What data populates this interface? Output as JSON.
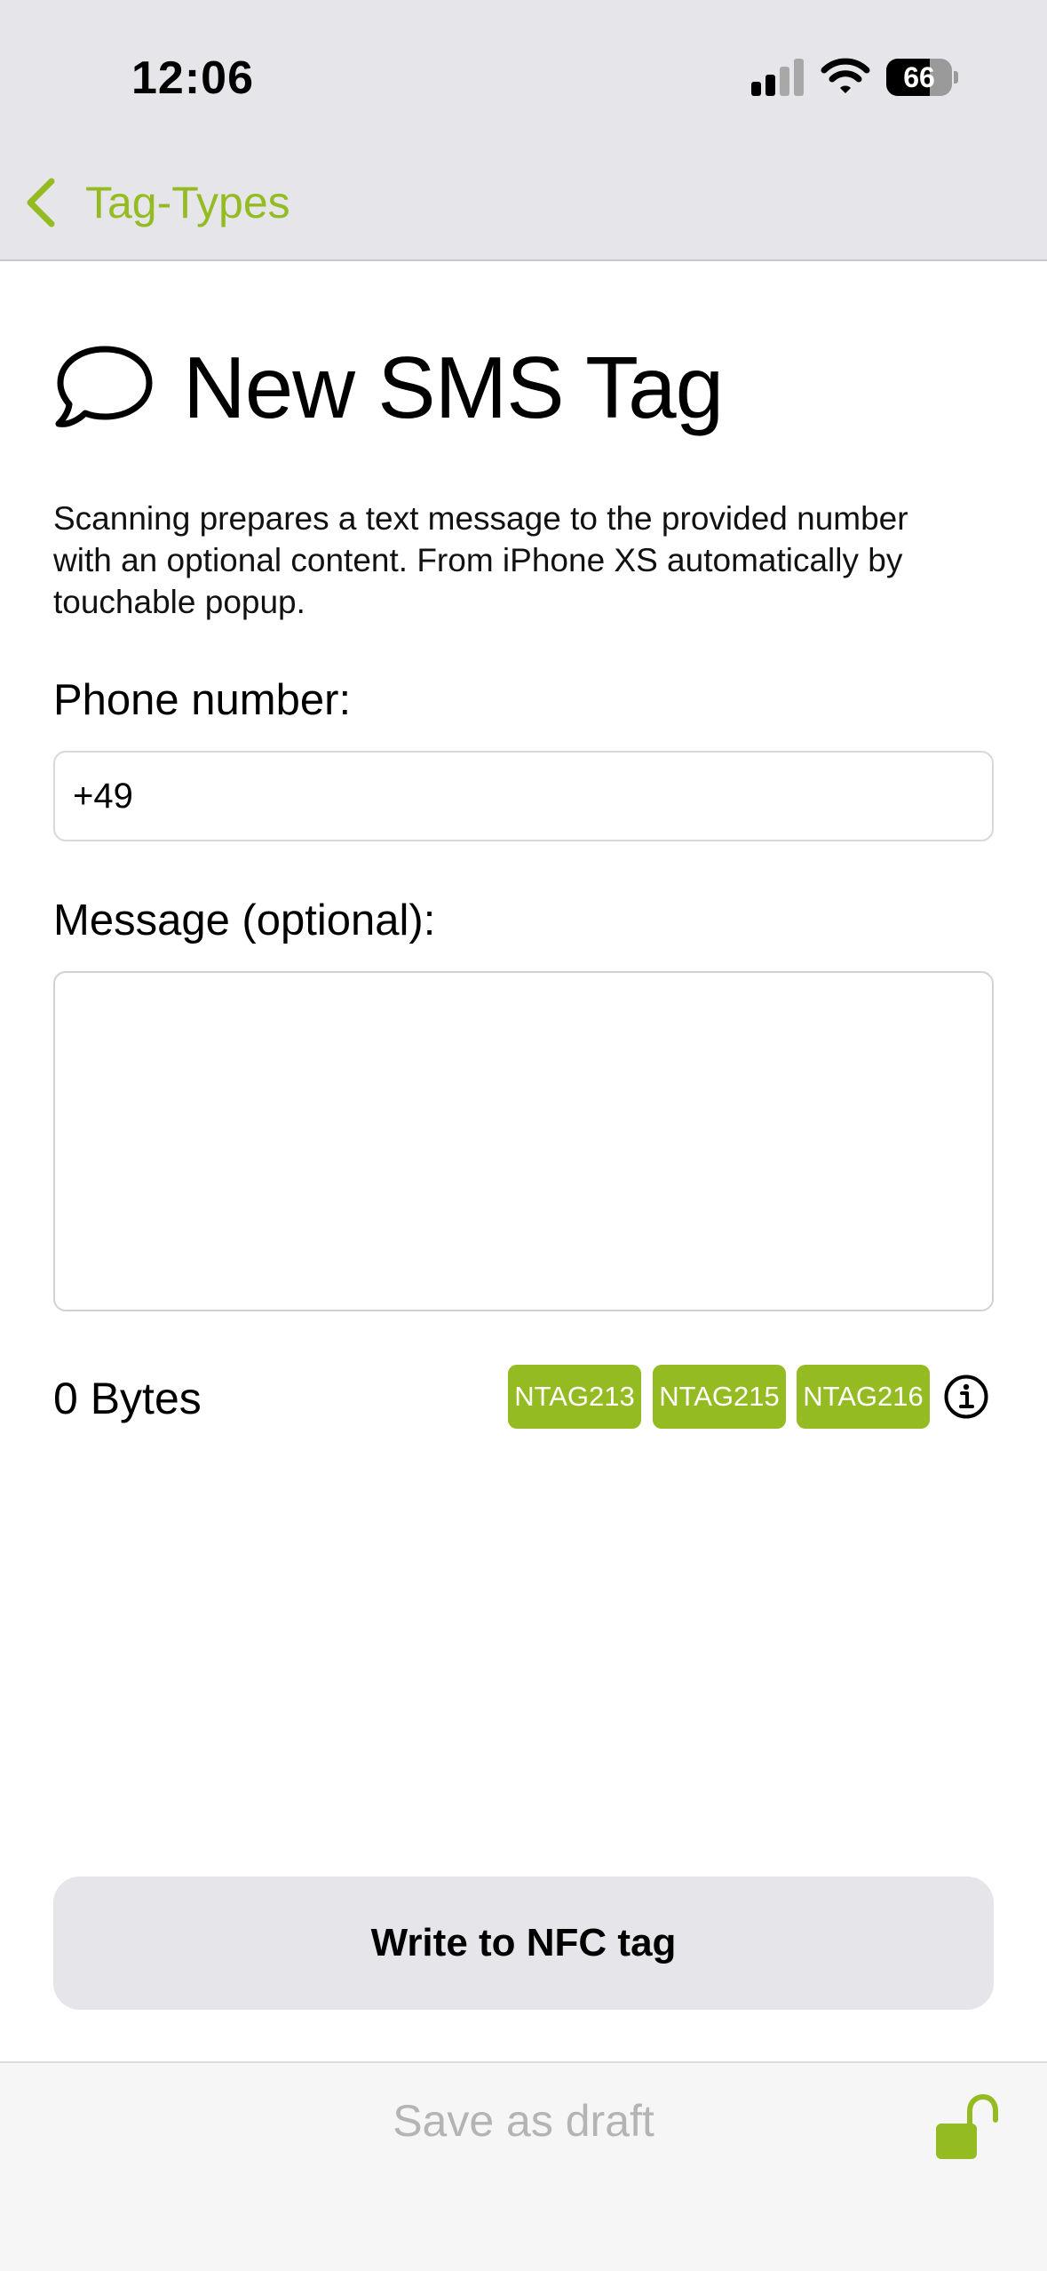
{
  "status_bar": {
    "time": "12:06",
    "battery_percent": "66",
    "battery_level": 0.66,
    "signal_bars_active": 2,
    "signal_bars_total": 4
  },
  "nav": {
    "back_label": "Tag-Types"
  },
  "main": {
    "title": "New SMS Tag",
    "description": "Scanning prepares a text message to the provided number with an optional content. From iPhone XS automatically by touchable popup.",
    "phone_label": "Phone number:",
    "phone_value": "+49",
    "message_label": "Message (optional):",
    "message_value": "",
    "bytes_label": "0 Bytes",
    "tag_types": [
      "NTAG213",
      "NTAG215",
      "NTAG216"
    ],
    "write_button_label": "Write to NFC tag"
  },
  "toolbar": {
    "save_draft_label": "Save as draft"
  },
  "colors": {
    "accent": "#95bb23",
    "header_bg": "#e6e6ea",
    "disabled_text": "#b4b4b4"
  },
  "icons": {
    "back": "chevron-left-icon",
    "title": "speech-bubble-icon",
    "info": "info-circle-icon",
    "lock": "unlocked-padlock-icon"
  }
}
